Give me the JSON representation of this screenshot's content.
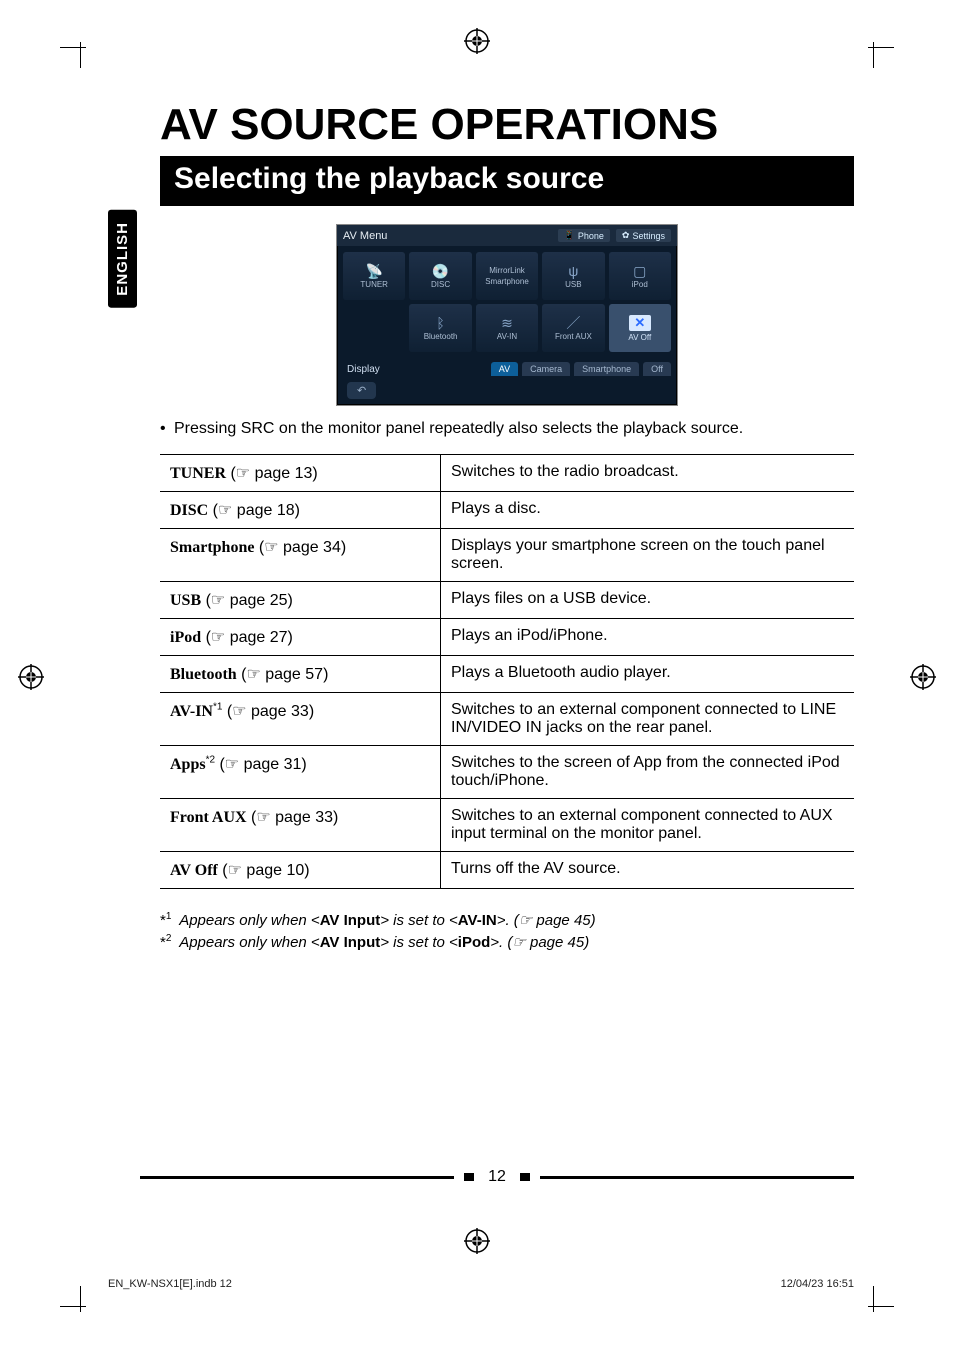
{
  "side_tab": "ENGLISH",
  "title": "AV SOURCE OPERATIONS",
  "section_bar": "Selecting the playback source",
  "avmenu": {
    "title": "AV Menu",
    "phone": "Phone",
    "settings": "Settings",
    "tiles": {
      "tuner": "TUNER",
      "disc": "DISC",
      "mirrorlink_top": "MirrorLink",
      "mirrorlink_bottom": "Smartphone",
      "usb": "USB",
      "ipod": "iPod",
      "bluetooth": "Bluetooth",
      "avin": "AV-IN",
      "frontaux": "Front AUX",
      "avoff": "AV Off"
    },
    "display": "Display",
    "tab_av": "AV",
    "tab_camera": "Camera",
    "tab_smartphone": "Smartphone",
    "tab_off": "Off",
    "back": "↶"
  },
  "note": "Pressing SRC on the monitor panel repeatedly also selects the playback source.",
  "rows": [
    {
      "key_bold": "TUNER",
      "key_rest": " (☞ page 13)",
      "val": "Switches to the radio broadcast."
    },
    {
      "key_bold": "DISC",
      "key_rest": " (☞ page 18)",
      "val": "Plays a disc."
    },
    {
      "key_bold": "Smartphone",
      "key_rest": " (☞ page 34)",
      "val": "Displays your smartphone screen on the touch panel screen."
    },
    {
      "key_bold": "USB",
      "key_rest": " (☞ page 25)",
      "val": "Plays files on a USB device."
    },
    {
      "key_bold": "iPod",
      "key_rest": " (☞ page 27)",
      "val": "Plays an iPod/iPhone."
    },
    {
      "key_bold": "Bluetooth",
      "key_rest": " (☞ page 57)",
      "val": "Plays a Bluetooth audio player."
    },
    {
      "key_bold": "AV-IN",
      "key_sup": "*1",
      "key_rest": " (☞ page 33)",
      "val": "Switches to an external component connected to LINE IN/VIDEO IN jacks on the rear panel."
    },
    {
      "key_bold": "Apps",
      "key_sup": "*2",
      "key_rest": " (☞ page 31)",
      "val": "Switches to the screen of App from the connected iPod touch/iPhone."
    },
    {
      "key_bold": "Front AUX",
      "key_rest": " (☞ page 33)",
      "val": "Switches to an external component connected to AUX input terminal on the monitor panel."
    },
    {
      "key_bold": "AV Off",
      "key_rest": " (☞ page 10)",
      "val": "Turns off the AV source."
    }
  ],
  "footnotes": {
    "f1_pre": "*",
    "f1_sup": "1",
    "f1_text_a": "Appears only when <",
    "f1_bold_a": "AV Input",
    "f1_text_b": "> is set to <",
    "f1_bold_b": "AV-IN",
    "f1_text_c": ">. (☞ page 45)",
    "f2_sup": "2",
    "f2_text_a": "Appears only when <",
    "f2_bold_a": "AV Input",
    "f2_text_b": "> is set to <",
    "f2_bold_b": "iPod",
    "f2_text_c": ">. (☞ page 45)"
  },
  "page_number": "12",
  "footer_left": "EN_KW-NSX1[E].indb   12",
  "footer_right": "12/04/23   16:51"
}
